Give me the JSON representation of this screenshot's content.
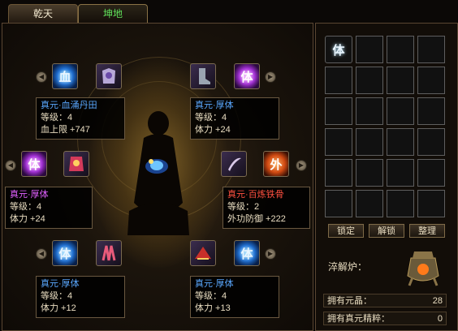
{
  "tabs": [
    {
      "label": "乾天",
      "active": false
    },
    {
      "label": "坤地",
      "active": true
    }
  ],
  "nodes": [
    {
      "gem_glyph": "血",
      "gem_color": "blue",
      "item": "armor",
      "title": "真元·血涌丹田",
      "level": "等级：4",
      "stat": "血上限 +747",
      "title_color": "#5aa8ff"
    },
    {
      "gem_glyph": "体",
      "gem_color": "purple",
      "item": "boots",
      "title": "真元·厚体",
      "level": "等级：4",
      "stat": "体力 +24",
      "title_color": "#5aa8ff"
    },
    {
      "gem_glyph": "体",
      "gem_color": "purple",
      "item": "robe",
      "title": "真元·厚体",
      "level": "等级：4",
      "stat": "体力 +24",
      "title_color": "#e060ff"
    },
    {
      "gem_glyph": "外",
      "gem_color": "orange",
      "item": "weapon",
      "title": "真元·百炼铁骨",
      "level": "等级：2",
      "stat": "外功防御 +222",
      "title_color": "#ff5040"
    },
    {
      "gem_glyph": "体",
      "gem_color": "blue",
      "item": "claw",
      "title": "真元·厚体",
      "level": "等级：4",
      "stat": "体力 +12",
      "title_color": "#5aa8ff"
    },
    {
      "gem_glyph": "体",
      "gem_color": "blue",
      "item": "hat",
      "title": "真元·厚体",
      "level": "等级：4",
      "stat": "体力 +13",
      "title_color": "#5aa8ff"
    }
  ],
  "inventory": {
    "first_slot_glyph": "体"
  },
  "buttons": {
    "lock": "锁定",
    "unlock": "解锁",
    "sort": "整理"
  },
  "furnace_label": "淬解炉：",
  "stats": [
    {
      "label": "拥有元晶：",
      "value": "28"
    },
    {
      "label": "拥有真元精粹：",
      "value": "0"
    }
  ],
  "colors": {
    "blue": "#5aa8ff",
    "purple": "#e060ff",
    "red": "#ff5040",
    "active_tab": "#5fe05a"
  }
}
